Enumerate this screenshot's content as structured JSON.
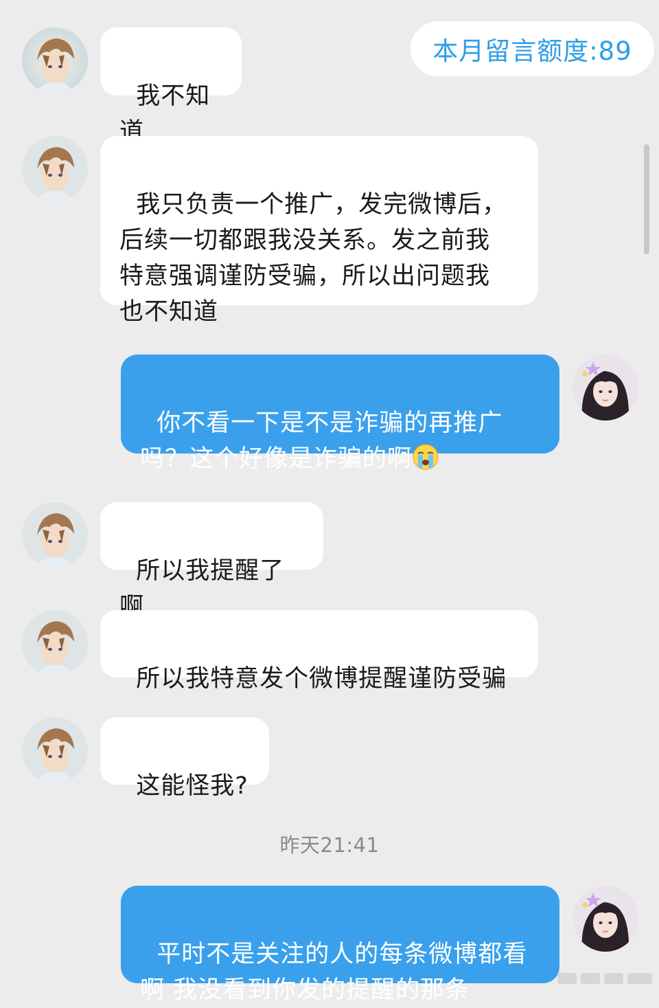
{
  "header": {
    "quota_label": "本月留言额度:89"
  },
  "messages": [
    {
      "side": "in",
      "text": "我不知道"
    },
    {
      "side": "in",
      "text": "我只负责一个推广，发完微博后，\n后续一切都跟我没关系。发之前我\n特意强调谨防受骗，所以出问题我\n也不知道"
    },
    {
      "side": "out",
      "text": "你不看一下是不是诈骗的再推广\n吗？这个好像是诈骗的啊",
      "emoji": "crying-face-icon"
    },
    {
      "side": "in",
      "text": "所以我提醒了啊"
    },
    {
      "side": "in",
      "text": "所以我特意发个微博提醒谨防受骗"
    },
    {
      "side": "in",
      "text": "这能怪我?"
    },
    {
      "side": "out",
      "text": "平时不是关注的人的每条微博都看\n啊 我没看到你发的提醒的那条"
    }
  ],
  "timestamp": "昨天21:41",
  "colors": {
    "background": "#ececec",
    "incoming_bubble": "#ffffff",
    "outgoing_bubble": "#3aa0ec",
    "quota_text": "#2e9ee6",
    "timestamp_text": "#8a8a8a"
  },
  "avatars": {
    "incoming": "anime-boy-avatar",
    "outgoing": "girl-photo-avatar"
  }
}
